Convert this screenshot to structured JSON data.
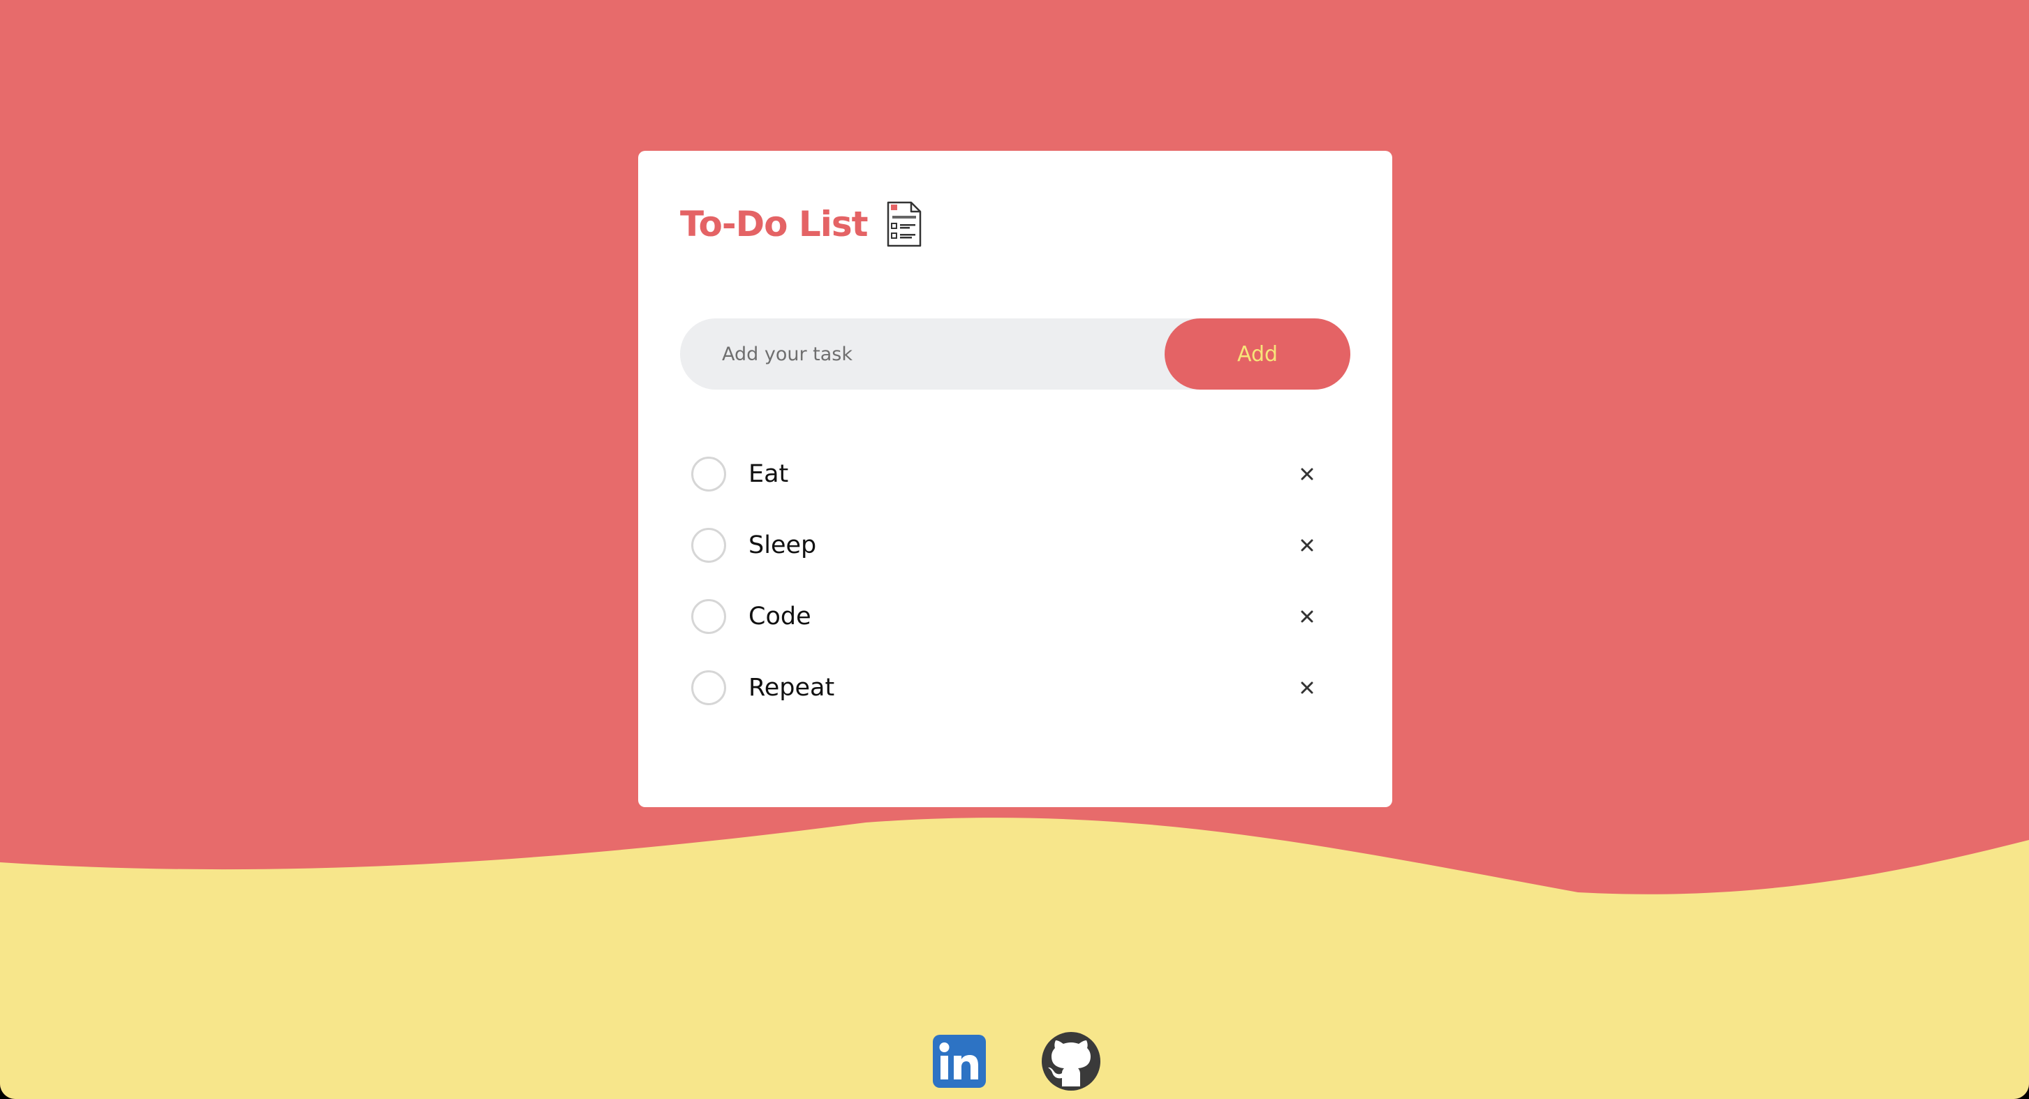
{
  "app": {
    "title": "To-Do List",
    "title_icon": "todo-document-icon"
  },
  "input": {
    "placeholder": "Add your task",
    "value": "",
    "add_label": "Add"
  },
  "tasks": [
    {
      "text": "Eat",
      "done": false
    },
    {
      "text": "Sleep",
      "done": false
    },
    {
      "text": "Code",
      "done": false
    },
    {
      "text": "Repeat",
      "done": false
    }
  ],
  "footer": {
    "links": [
      {
        "name": "linkedin-icon"
      },
      {
        "name": "github-icon"
      }
    ]
  },
  "colors": {
    "background": "#e76b6b",
    "wave": "#f7e68b",
    "accent": "#e46365",
    "button_text": "#f7e57a",
    "input_bg": "#edeef0"
  }
}
